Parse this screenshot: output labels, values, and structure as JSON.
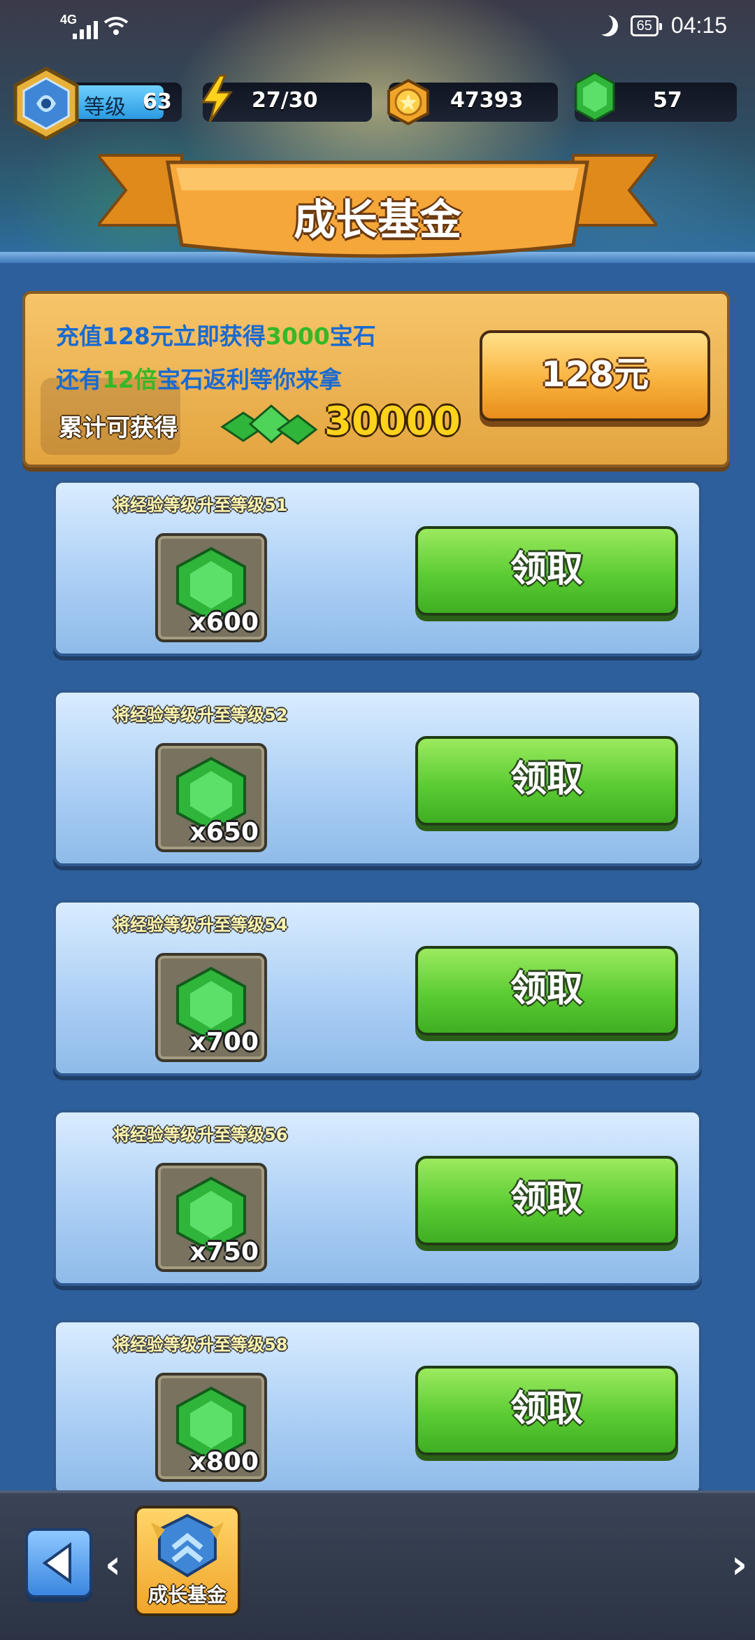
{
  "status_bar": {
    "network": "4G",
    "battery": "65",
    "time": "04:15"
  },
  "resources": {
    "level_label": "等级",
    "level": "63",
    "energy": "27/30",
    "coins": "47393",
    "gems": "57"
  },
  "banner": {
    "title": "成长基金"
  },
  "promo": {
    "line1_pre": "充值",
    "line1_amount": "128",
    "line1_mid": "元立即获得",
    "line1_gems": "3000",
    "line1_post": "宝石",
    "line2_pre": "还有",
    "line2_mult": "12倍",
    "line2_post": "宝石返利等你来拿",
    "cumulative_label": "累计可获得",
    "cumulative_total": "30000",
    "buy_label": "128元"
  },
  "rewards": [
    {
      "requirement": "将经验等级升至等级51",
      "count": "x600",
      "claim_label": "领取"
    },
    {
      "requirement": "将经验等级升至等级52",
      "count": "x650",
      "claim_label": "领取"
    },
    {
      "requirement": "将经验等级升至等级54",
      "count": "x700",
      "claim_label": "领取"
    },
    {
      "requirement": "将经验等级升至等级56",
      "count": "x750",
      "claim_label": "领取"
    },
    {
      "requirement": "将经验等级升至等级58",
      "count": "x800",
      "claim_label": "领取"
    }
  ],
  "bottom_nav": {
    "tab_label": "成长基金"
  },
  "colors": {
    "gem_green": "#3fc23a",
    "claim_green": "#5ccc33",
    "buy_orange": "#f9b33f",
    "promo_blue": "#1a6ad0"
  }
}
